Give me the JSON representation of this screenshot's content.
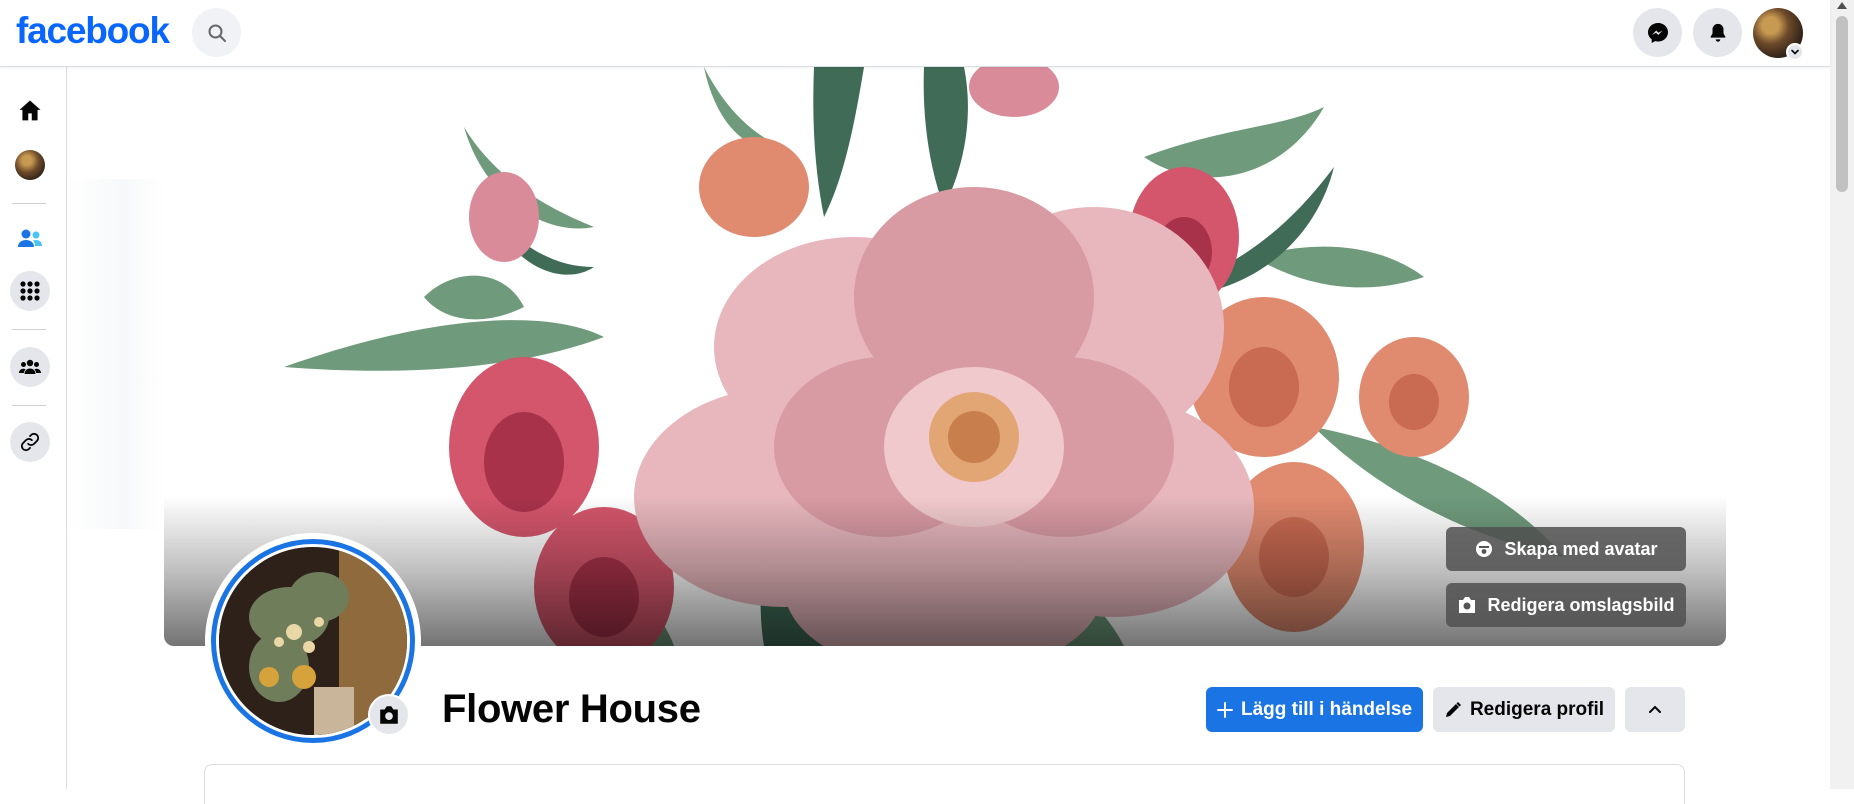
{
  "topbar": {
    "logo": "facebook",
    "search_icon": "search-icon",
    "messenger_icon": "messenger-icon",
    "notifications_icon": "bell-icon"
  },
  "leftrail": {
    "items": [
      "home-icon",
      "profile-avatar",
      "friends-icon",
      "apps-grid-icon",
      "groups-icon",
      "link-icon"
    ]
  },
  "cover": {
    "create_avatar_label": "Skapa med avatar",
    "edit_cover_label": "Redigera omslagsbild"
  },
  "profile": {
    "name": "Flower House"
  },
  "actions": {
    "add_to_event_label": "Lägg till i händelse",
    "edit_profile_label": "Redigera profil"
  },
  "colors": {
    "brand": "#0866ff",
    "primary_button": "#1b74e4",
    "secondary_button": "#e4e6eb",
    "friends_icon": "#1b74e4"
  }
}
